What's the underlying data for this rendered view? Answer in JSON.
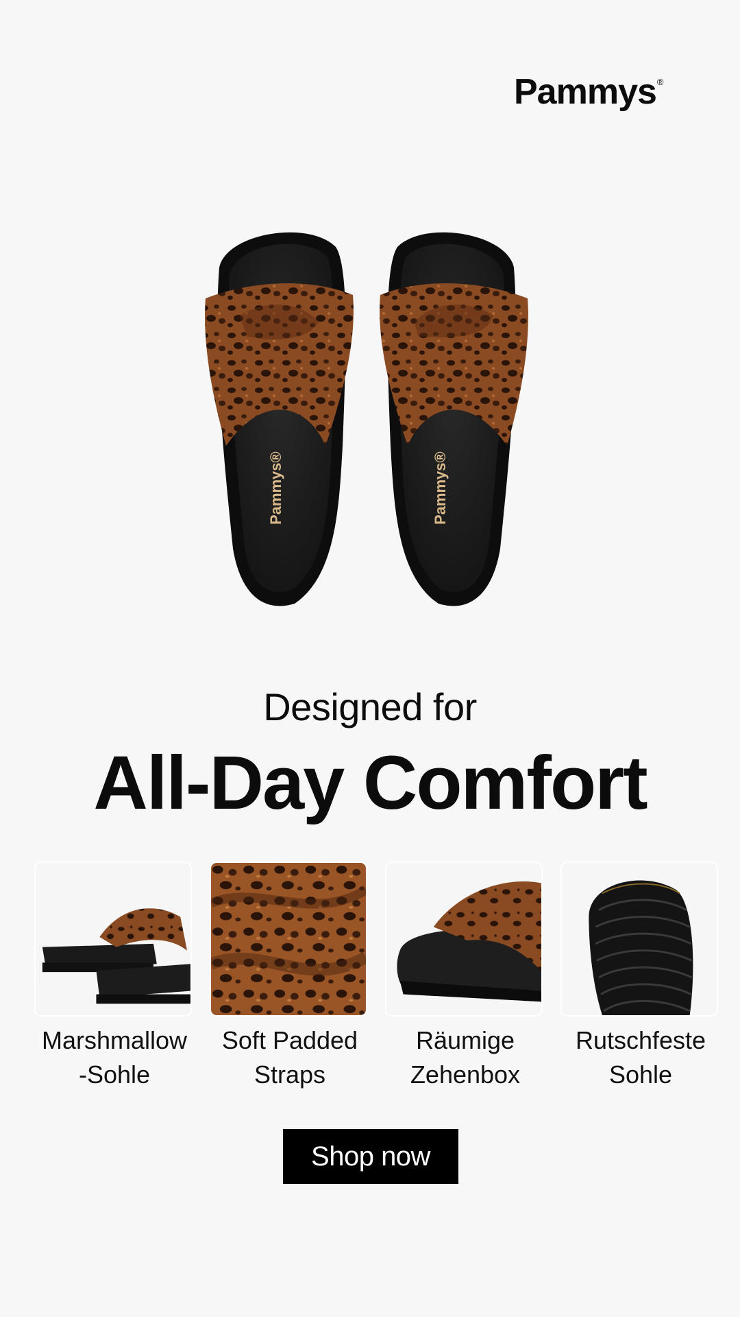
{
  "brand": {
    "name": "Pammys",
    "trademark": "®"
  },
  "hero": {
    "insole_print": "Pammys®"
  },
  "headline": {
    "line1": "Designed for",
    "line2": "All-Day Comfort"
  },
  "features": [
    {
      "label_line1": "Marshmallow",
      "label_line2": "-Sohle",
      "icon": "side-view-sandal-image"
    },
    {
      "label_line1": "Soft Padded",
      "label_line2": "Straps",
      "icon": "leopard-strap-closeup-image"
    },
    {
      "label_line1": "Räumige",
      "label_line2": "Zehenbox",
      "icon": "toe-box-closeup-image"
    },
    {
      "label_line1": "Rutschfeste",
      "label_line2": "Sohle",
      "icon": "outsole-tread-image"
    }
  ],
  "cta": {
    "label": "Shop now"
  },
  "colors": {
    "background": "#f7f7f7",
    "text": "#0c0c0c",
    "cta_bg": "#000000",
    "cta_text": "#ffffff",
    "leopard": "#7a3f1f",
    "sole": "#1c1c1c",
    "print": "#d9b98a"
  }
}
